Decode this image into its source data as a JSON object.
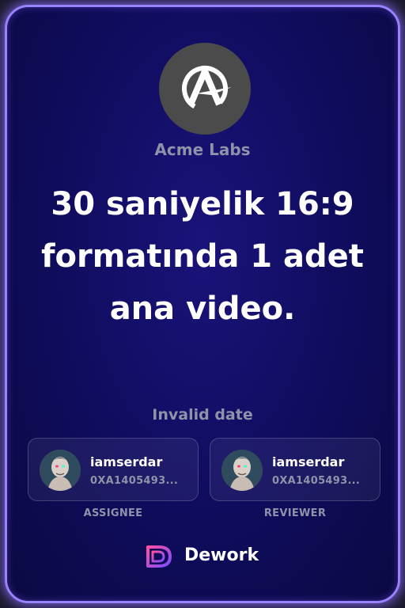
{
  "organization": {
    "logo_icon": "acme-a-logo",
    "name": "Acme Labs"
  },
  "task": {
    "title": "30 saniyelik 16:9 formatında 1 adet ana video.",
    "date": "Invalid date"
  },
  "assignee": {
    "name": "iamserdar",
    "address": "0XA1405493...",
    "role": "ASSIGNEE"
  },
  "reviewer": {
    "name": "iamserdar",
    "address": "0XA1405493...",
    "role": "REVIEWER"
  },
  "footer": {
    "brand_icon": "dework-logo",
    "brand_name": "Dework"
  },
  "colors": {
    "card_background": "#0f0c5c",
    "border_glow": "#9a82ff",
    "muted_text": "#8f93a9",
    "brand_gradient_start": "#ff4fa3",
    "brand_gradient_end": "#7a4dff"
  }
}
